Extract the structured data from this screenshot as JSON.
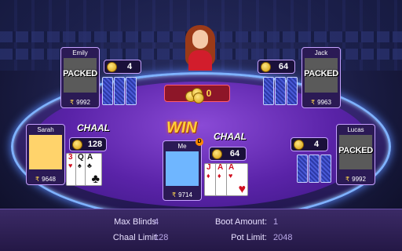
{
  "players": {
    "emily": {
      "name": "Emily",
      "status": "PACKED",
      "chips": "9992",
      "bet": "4"
    },
    "jack": {
      "name": "Jack",
      "status": "PACKED",
      "chips": "9963",
      "bet": "64"
    },
    "sarah": {
      "name": "Sarah",
      "chips": "9648",
      "bet": "128",
      "action": "CHAAL"
    },
    "me": {
      "name": "Me",
      "chips": "9714",
      "bet": "64",
      "action": "CHAAL",
      "result": "WIN"
    },
    "lucas": {
      "name": "Lucas",
      "status": "PACKED",
      "chips": "9992",
      "bet": "4"
    }
  },
  "currency_symbol": "₹",
  "dealer_badge": "D",
  "pot_label": "0",
  "cards": {
    "sarah": [
      {
        "rank": "3",
        "suit": "♥",
        "color": "red"
      },
      {
        "rank": "Q",
        "suit": "♠",
        "color": "black"
      },
      {
        "rank": "A",
        "suit": "♣",
        "color": "black"
      }
    ],
    "me": [
      {
        "rank": "J",
        "suit": "♦",
        "color": "red"
      },
      {
        "rank": "A",
        "suit": "♦",
        "color": "red"
      },
      {
        "rank": "A",
        "suit": "♥",
        "color": "red"
      }
    ]
  },
  "info": {
    "max_blinds_label": "Max Blinds:",
    "max_blinds": "4",
    "boot_amount_label": "Boot Amount:",
    "boot_amount": "1",
    "chaal_limit_label": "Chaal Limit:",
    "chaal_limit": "128",
    "pot_limit_label": "Pot Limit:",
    "pot_limit": "2048"
  },
  "colors": {
    "accent": "#ffd84d",
    "felt": "#6a2fc0",
    "rim": "#7fb2ff",
    "win": "#ffcf3a"
  }
}
